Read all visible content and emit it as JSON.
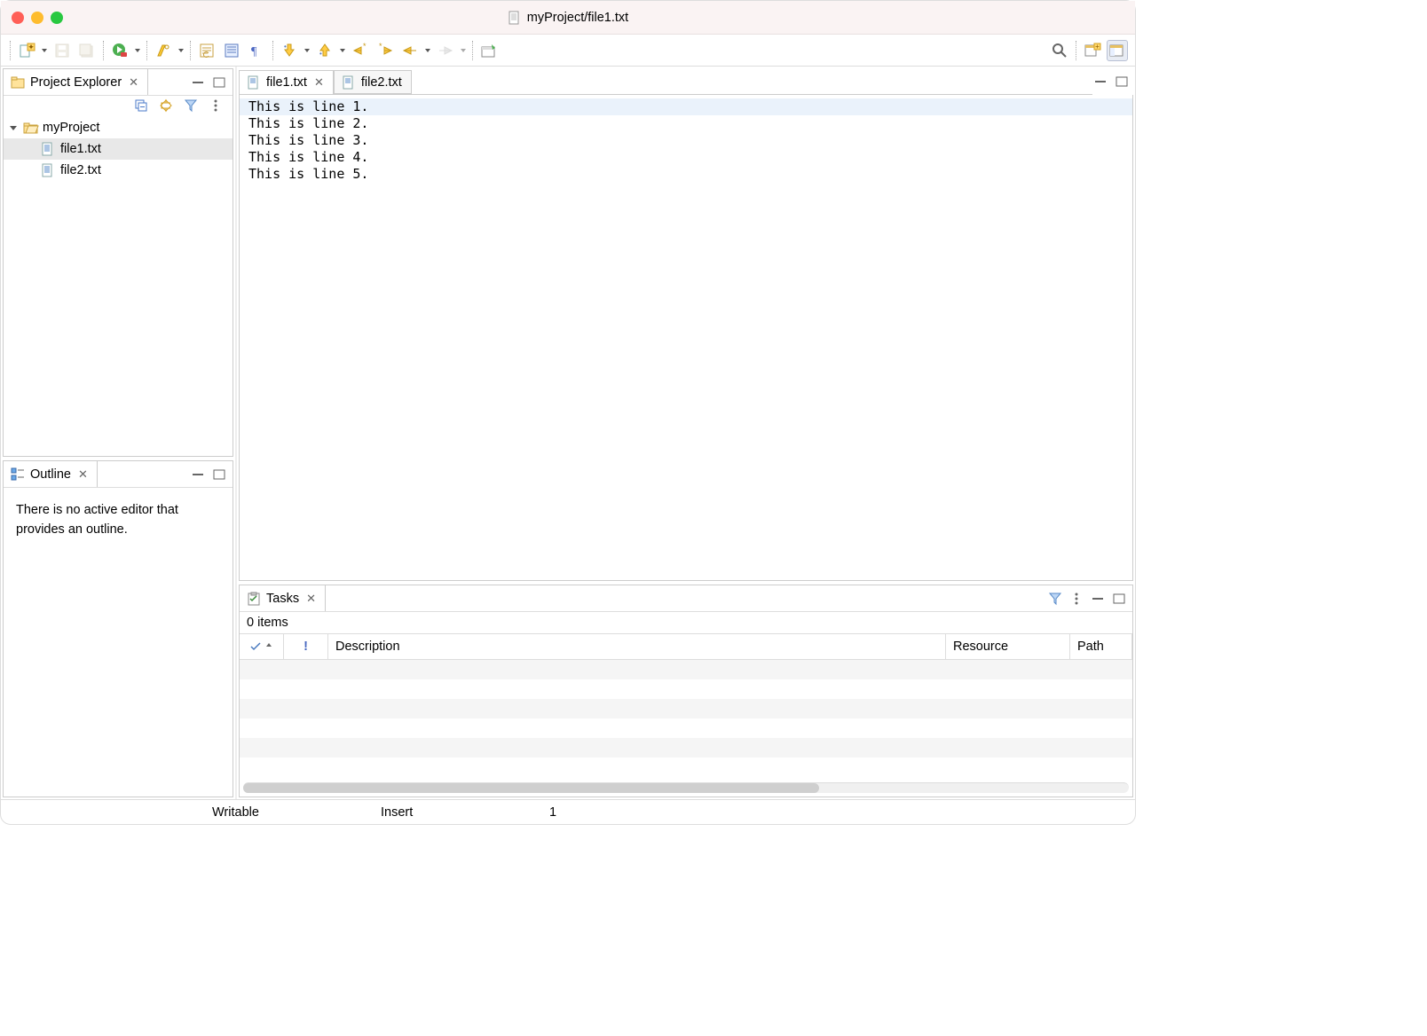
{
  "window": {
    "title": "myProject/file1.txt"
  },
  "projectExplorer": {
    "title": "Project Explorer",
    "tree": {
      "project": "myProject",
      "files": [
        "file1.txt",
        "file2.txt"
      ],
      "selected": "file1.txt"
    }
  },
  "outline": {
    "title": "Outline",
    "message": "There is no active editor that provides an outline."
  },
  "editor": {
    "tabs": [
      {
        "name": "file1.txt",
        "active": true
      },
      {
        "name": "file2.txt",
        "active": false
      }
    ],
    "lines": [
      "This is line 1.",
      "This is line 2.",
      "This is line 3.",
      "This is line 4.",
      "This is line 5."
    ],
    "currentLine": 0
  },
  "tasks": {
    "title": "Tasks",
    "count": "0 items",
    "columns": {
      "description": "Description",
      "resource": "Resource",
      "path": "Path"
    }
  },
  "statusbar": {
    "writable": "Writable",
    "mode": "Insert",
    "pos": "1"
  }
}
